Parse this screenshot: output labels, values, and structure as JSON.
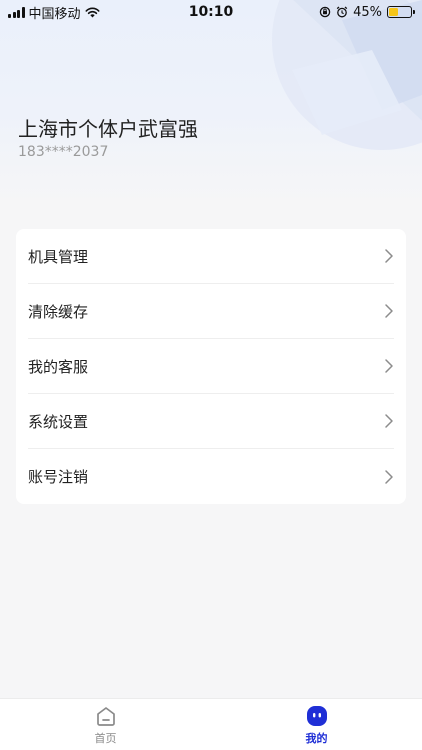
{
  "status_bar": {
    "carrier": "中国移动",
    "time": "10:10",
    "battery_percent": "45%",
    "battery_level": 0.45
  },
  "profile": {
    "name": "上海市个体户武富强",
    "phone": "183****2037"
  },
  "menu": {
    "items": [
      {
        "label": "机具管理"
      },
      {
        "label": "清除缓存"
      },
      {
        "label": "我的客服"
      },
      {
        "label": "系统设置"
      },
      {
        "label": "账号注销"
      }
    ]
  },
  "tabbar": {
    "tabs": [
      {
        "label": "首页",
        "icon": "home-icon",
        "active": false
      },
      {
        "label": "我的",
        "icon": "profile-face-icon",
        "active": true
      }
    ],
    "active_color": "#1f2fd6"
  }
}
